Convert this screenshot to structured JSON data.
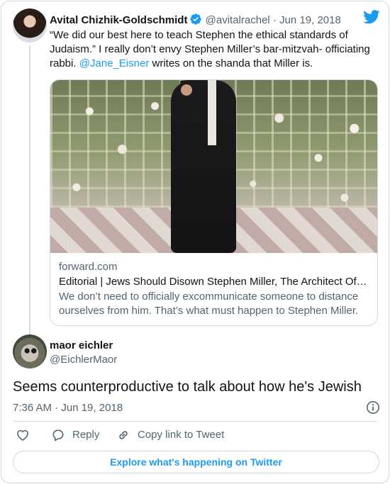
{
  "parent_tweet": {
    "author_name": "Avital Chizhik-Goldschmidt",
    "handle": "@avitalrachel",
    "separator": "·",
    "date": "Jun 19, 2018",
    "text_before_mention": "“We did our best here to teach Stephen the ethical standards of Judaism.” I really don’t envy Stephen Miller’s bar-mitzvah- officiating rabbi. ",
    "mention": "@Jane_Eisner",
    "text_after_mention": " writes on the shanda that Miller is."
  },
  "link_card": {
    "domain": "forward.com",
    "title": "Editorial | Jews Should Disown Stephen Miller, The Architect Of…",
    "description": "We don’t need to officially excommunicate someone to distance ourselves from him. That’s what must happen to Stephen Miller."
  },
  "main_tweet": {
    "author_name": "maor eichler",
    "handle": "@EichlerMaor",
    "text": "Seems counterproductive to talk about how he's Jewish",
    "timestamp": "7:36 AM · Jun 19, 2018"
  },
  "actions": {
    "reply_label": "Reply",
    "copy_link_label": "Copy link to Tweet"
  },
  "explore_label": "Explore what's happening on Twitter",
  "colors": {
    "accent": "#1d9bf0",
    "text": "#0f1419",
    "secondary_text": "#536471",
    "border": "#cfd9de"
  },
  "icons": [
    "verified-badge-icon",
    "twitter-bird-icon",
    "info-icon",
    "heart-icon",
    "reply-bubble-icon",
    "link-icon"
  ]
}
